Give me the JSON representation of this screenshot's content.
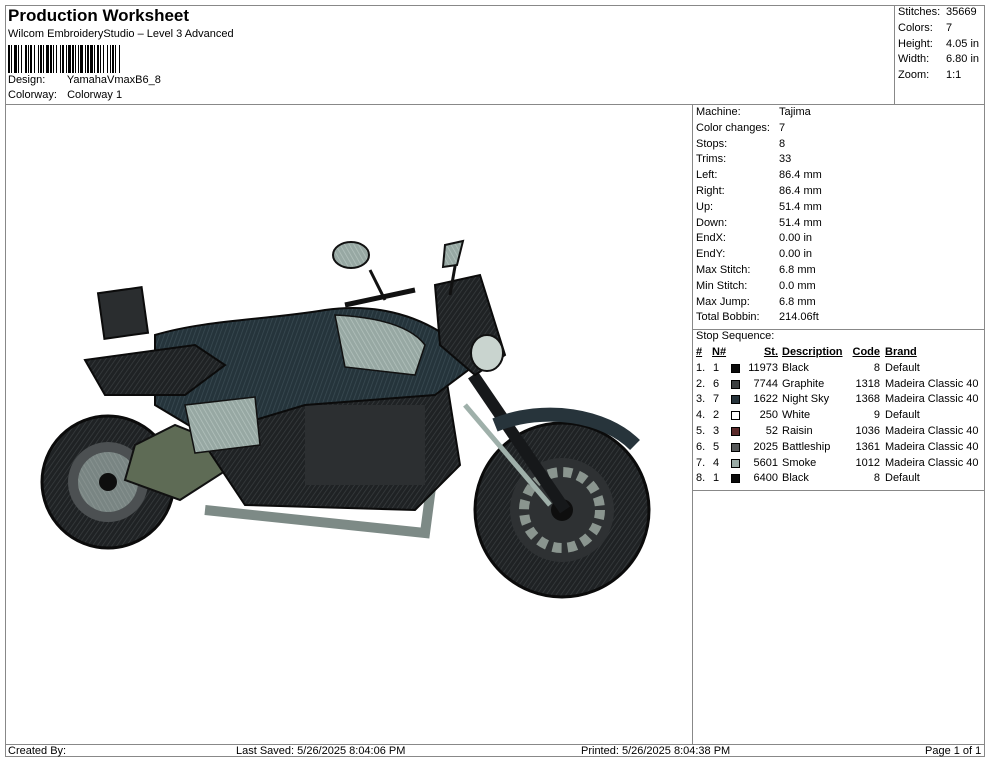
{
  "header": {
    "title": "Production Worksheet",
    "subtitle": "Wilcom EmbroideryStudio – Level 3 Advanced",
    "design_label": "Design:",
    "design_value": "YamahaVmaxB6_8",
    "colorway_label": "Colorway:",
    "colorway_value": "Colorway 1"
  },
  "stats": [
    {
      "label": "Stitches:",
      "value": "35669"
    },
    {
      "label": "Colors:",
      "value": "7"
    },
    {
      "label": "Height:",
      "value": "4.05 in"
    },
    {
      "label": "Width:",
      "value": "6.80 in"
    },
    {
      "label": "Zoom:",
      "value": "1:1"
    }
  ],
  "machine_info": [
    {
      "label": "Machine:",
      "value": "Tajima"
    },
    {
      "label": "Color changes:",
      "value": "7"
    },
    {
      "label": "Stops:",
      "value": "8"
    },
    {
      "label": "Trims:",
      "value": "33"
    },
    {
      "label": "Left:",
      "value": "86.4 mm"
    },
    {
      "label": "Right:",
      "value": "86.4 mm"
    },
    {
      "label": "Up:",
      "value": "51.4 mm"
    },
    {
      "label": "Down:",
      "value": "51.4 mm"
    },
    {
      "label": "EndX:",
      "value": "0.00 in"
    },
    {
      "label": "EndY:",
      "value": "0.00 in"
    },
    {
      "label": "Max Stitch:",
      "value": "6.8 mm"
    },
    {
      "label": "Min Stitch:",
      "value": "0.0 mm"
    },
    {
      "label": "Max Jump:",
      "value": "6.8 mm"
    },
    {
      "label": "Total Bobbin:",
      "value": "214.06ft"
    }
  ],
  "stop_sequence": {
    "label": "Stop Sequence:",
    "headers": {
      "num": "#",
      "n": "N#",
      "st": "St.",
      "desc": "Description",
      "code": "Code",
      "brand": "Brand"
    },
    "rows": [
      {
        "num": "1.",
        "n": "1",
        "color": "#0a0a0a",
        "st": "11973",
        "desc": "Black",
        "code": "8",
        "brand": "Default"
      },
      {
        "num": "2.",
        "n": "6",
        "color": "#3c3f40",
        "st": "7744",
        "desc": "Graphite",
        "code": "1318",
        "brand": "Madeira Classic 40"
      },
      {
        "num": "3.",
        "n": "7",
        "color": "#27343b",
        "st": "1622",
        "desc": "Night Sky",
        "code": "1368",
        "brand": "Madeira Classic 40"
      },
      {
        "num": "4.",
        "n": "2",
        "color": "#ffffff",
        "st": "250",
        "desc": "White",
        "code": "9",
        "brand": "Default"
      },
      {
        "num": "5.",
        "n": "3",
        "color": "#5a2a2a",
        "st": "52",
        "desc": "Raisin",
        "code": "1036",
        "brand": "Madeira Classic 40"
      },
      {
        "num": "6.",
        "n": "5",
        "color": "#555758",
        "st": "2025",
        "desc": "Battleship",
        "code": "1361",
        "brand": "Madeira Classic 40"
      },
      {
        "num": "7.",
        "n": "4",
        "color": "#9aaba6",
        "st": "5601",
        "desc": "Smoke",
        "code": "1012",
        "brand": "Madeira Classic 40"
      },
      {
        "num": "8.",
        "n": "1",
        "color": "#0a0a0a",
        "st": "6400",
        "desc": "Black",
        "code": "8",
        "brand": "Default"
      }
    ]
  },
  "footer": {
    "created_by": "Created By:",
    "last_saved": "Last Saved: 5/26/2025 8:04:06 PM",
    "printed": "Printed: 5/26/2025 8:04:38 PM",
    "page": "Page 1 of 1"
  }
}
